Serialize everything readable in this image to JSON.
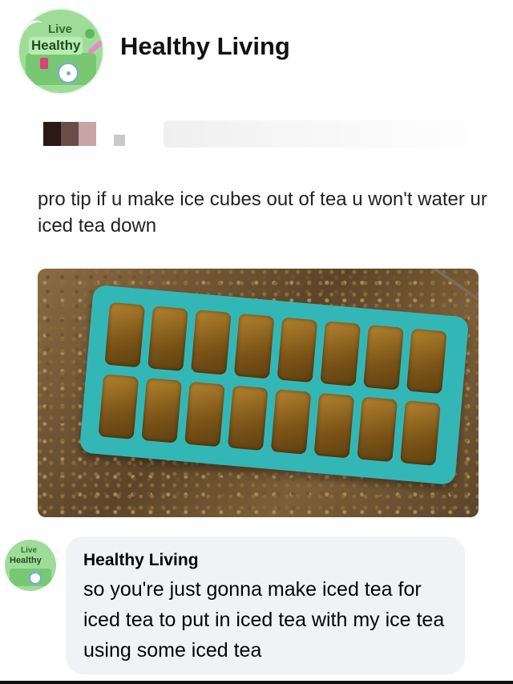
{
  "post": {
    "page_name": "Healthy Living",
    "avatar": {
      "line1": "Live",
      "line2": "Healthy"
    },
    "tweet_text": "pro tip if u make ice cubes out of tea u won't water ur iced tea down"
  },
  "comment": {
    "author": "Healthy Living",
    "body": "so you're just gonna make iced tea for iced tea to put in iced tea with my ice tea using some iced tea",
    "avatar": {
      "line1": "Live",
      "line2": "Healthy"
    }
  },
  "colors": {
    "tray": "#33b7b6",
    "comment_bubble": "#f0f2f5",
    "avatar_bg": "#9fdc9a"
  }
}
